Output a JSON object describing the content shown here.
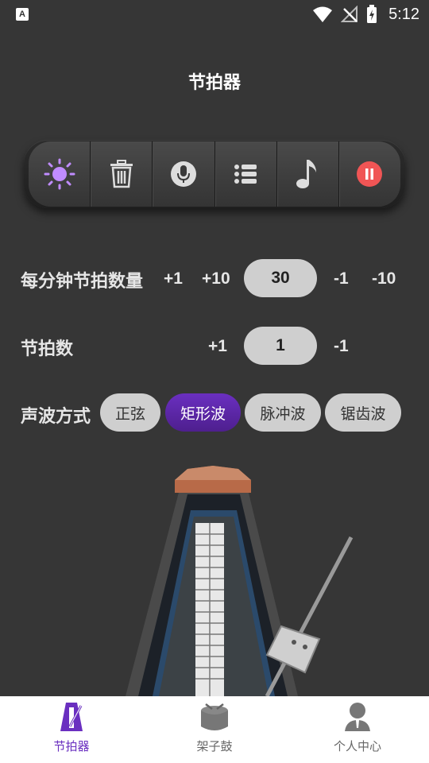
{
  "status": {
    "badge": "A",
    "time": "5:12"
  },
  "page": {
    "title": "节拍器"
  },
  "toolbar": {
    "items": [
      {
        "name": "light-icon",
        "color": "#c08cff"
      },
      {
        "name": "trash-icon"
      },
      {
        "name": "microphone-icon"
      },
      {
        "name": "list-icon"
      },
      {
        "name": "music-note-icon"
      },
      {
        "name": "pause-icon",
        "color": "#f05555"
      }
    ]
  },
  "bpm": {
    "label": "每分钟节拍数量",
    "plus1": "+1",
    "plus10": "+10",
    "value": "30",
    "minus1": "-1",
    "minus10": "-10"
  },
  "beats": {
    "label": "节拍数",
    "plus1": "+1",
    "value": "1",
    "minus1": "-1"
  },
  "wave": {
    "label": "声波方式",
    "options": [
      "正弦",
      "矩形波",
      "脉冲波",
      "锯齿波"
    ],
    "selected": "矩形波"
  },
  "nav": {
    "items": [
      {
        "label": "节拍器",
        "icon": "metronome-icon",
        "active": true
      },
      {
        "label": "架子鼓",
        "icon": "drum-icon",
        "active": false
      },
      {
        "label": "个人中心",
        "icon": "person-icon",
        "active": false
      }
    ],
    "active_color": "#6a2fc0"
  }
}
